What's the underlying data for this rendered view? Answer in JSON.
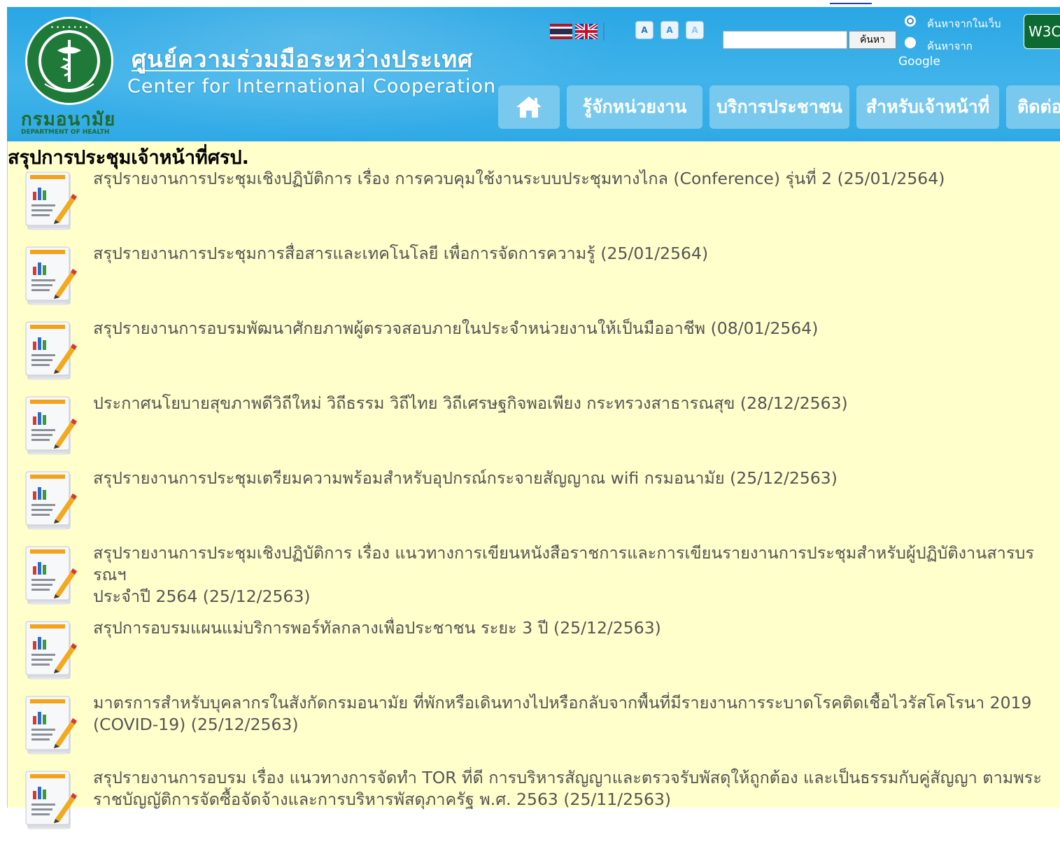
{
  "header": {
    "department_th": "กรมอนามัย",
    "department_en": "DEPARTMENT OF HEALTH",
    "site_title_th": "ศูนย์ความร่วมมือระหว่างประเทศ",
    "site_title_en": "Center for International Cooperation",
    "logo_icon": "ministry-seal-icon",
    "flags": [
      "thai-flag-icon",
      "uk-flag-icon"
    ],
    "font_size_buttons": [
      "A",
      "A",
      "A"
    ],
    "search": {
      "value": "",
      "button_label": "ค้นหา",
      "option_site": "ค้นหาจากในเว็บ",
      "option_google": "ค้นหาจาก",
      "google_label": "Google",
      "selected": "site"
    },
    "w3c_badge": "W3C",
    "nav": {
      "home_icon": "home-icon",
      "items": [
        "รู้จักหน่วยงาน",
        "บริการประชาชน",
        "สำหรับเจ้าหน้าที่",
        "ติดต่อ"
      ]
    },
    "colors": {
      "header_blue": "#29a6e4",
      "nav_button": "#79c9ef",
      "page_bg": "#ffffcc",
      "link_text": "#545454",
      "dept_green": "#1e6b2a"
    }
  },
  "page": {
    "title": "สรุปการประชุมเจ้าหน้าที่ศรป.",
    "item_icon": "report-chart-pencil-icon",
    "items": [
      "สรุปรายงานการประชุมเชิงปฏิบัติการ เรื่อง การควบคุมใช้งานระบบประชุมทางไกล (Conference) รุ่นที่ 2 (25/01/2564)",
      "สรุปรายงานการประชุมการสื่อสารและเทคโนโลยี เพื่อการจัดการความรู้ (25/01/2564)",
      "สรุปรายงานการอบรมพัฒนาศักยภาพผู้ตรวจสอบภายในประจำหน่วยงานให้เป็นมืออาชีพ (08/01/2564)",
      "ประกาศนโยบายสุขภาพดีวิถีใหม่ วิถีธรรม วิถีไทย วิถีเศรษฐกิจพอเพียง กระทรวงสาธารณสุข (28/12/2563)",
      "สรุปรายงานการประชุมเตรียมความพร้อมสำหรับอุปกรณ์กระจายสัญญาณ wifi กรมอนามัย (25/12/2563)",
      "สรุปรายงานการประชุมเชิงปฏิบัติการ เรื่อง แนวทางการเขียนหนังสือราชการและการเขียนรายงานการประชุมสำหรับผู้ปฏิบัติงานสารบรรณฯ\nประจำปี 2564 (25/12/2563)",
      "สรุปการอบรมแผนแม่บริการพอร์ทัลกลางเพื่อประชาชน ระยะ 3 ปี (25/12/2563)",
      "มาตรการสำหรับบุคลากรในสังกัดกรมอนามัย ที่พักหรือเดินทางไปหรือกลับจากพื้นที่มีรายงานการระบาดโรคติดเชื้อไวรัสโคโรนา 2019\n(COVID-19) (25/12/2563)",
      "สรุปรายงานการอบรม เรื่อง แนวทางการจัดทำ TOR ที่ดี การบริหารสัญญาและตรวจรับพัสดุให้ถูกต้อง และเป็นธรรมกับคู่สัญญา ตามพระ\nราชบัญญัติการจัดซื้อจัดจ้างและการบริหารพัสดุภาครัฐ พ.ศ. 2563 (25/11/2563)"
    ]
  }
}
